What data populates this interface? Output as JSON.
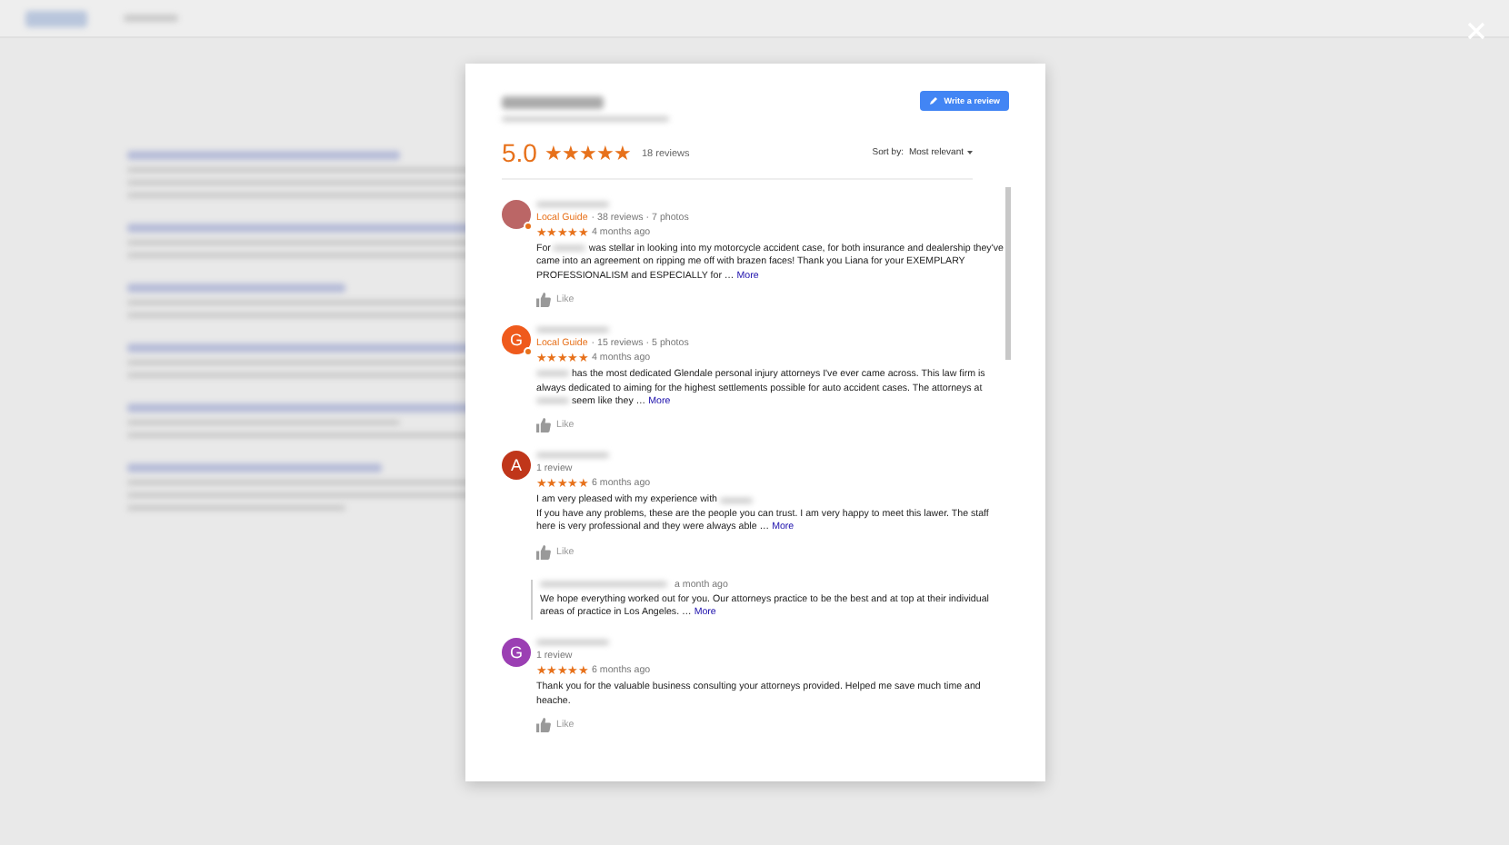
{
  "dialog": {
    "rating": "5.0",
    "stars": 5,
    "review_count": "18 reviews",
    "write_button": "Write a review",
    "sort_label": "Sort by:",
    "sort_value": "Most relevant",
    "reviews": [
      {
        "avatar": {
          "kind": "photo"
        },
        "local_guide": true,
        "guide_label": "Local Guide",
        "meta": "· 38 reviews · 7 photos",
        "stars": 5,
        "time": "4 months ago",
        "text_parts": [
          {
            "kind": "text",
            "text": "For"
          },
          {
            "kind": "redacted"
          },
          {
            "kind": "text",
            "text": "was stellar in looking into my motorcycle accident case, for both insurance and dealership they've came into an agreement on ripping me off with brazen faces! Thank you Liana for your EXEMPLARY PROFESSIONALISM and ESPECIALLY for …"
          }
        ],
        "more": "More",
        "like": "Like"
      },
      {
        "avatar": {
          "kind": "letter",
          "letter": "G",
          "color": "#ef5a1c"
        },
        "local_guide": true,
        "guide_label": "Local Guide",
        "meta": "· 15 reviews · 5 photos",
        "stars": 5,
        "time": "4 months ago",
        "text_parts": [
          {
            "kind": "redacted"
          },
          {
            "kind": "text",
            "text": "has the most dedicated Glendale personal injury attorneys I've ever came across. This law firm is always dedicated to aiming for the highest settlements possible for auto accident cases. The attorneys at"
          },
          {
            "kind": "redacted"
          },
          {
            "kind": "text",
            "text": "seem like they …"
          }
        ],
        "more": "More",
        "like": "Like"
      },
      {
        "avatar": {
          "kind": "letter",
          "letter": "A",
          "color": "#c0361a"
        },
        "local_guide": false,
        "meta": "1 review",
        "stars": 5,
        "time": "6 months ago",
        "text_parts": [
          {
            "kind": "text",
            "text": "I am very pleased with my experience with"
          },
          {
            "kind": "redacted"
          },
          {
            "kind": "break"
          },
          {
            "kind": "text",
            "text": "If you have any problems, these are the people you can trust. I am very happy to meet this lawer. The staff here is very professional and they were always able …"
          }
        ],
        "more": "More",
        "like": "Like",
        "response": {
          "time": "a month ago",
          "text": "We hope everything worked out for you. Our attorneys practice to be the best and at top at their individual areas of practice in Los Angeles. …",
          "more": "More"
        }
      },
      {
        "avatar": {
          "kind": "letter",
          "letter": "G",
          "color": "#9b3fb3"
        },
        "local_guide": false,
        "meta": "1 review",
        "stars": 5,
        "time": "6 months ago",
        "text_parts": [
          {
            "kind": "text",
            "text": "Thank you for the valuable business consulting your attorneys provided.  Helped me save much time and heache."
          }
        ],
        "like": "Like"
      }
    ]
  }
}
